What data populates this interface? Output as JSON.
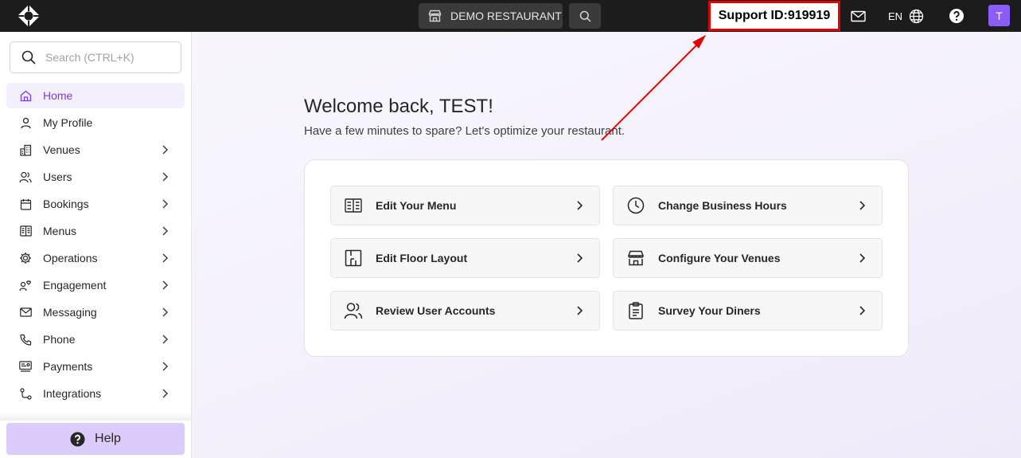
{
  "topbar": {
    "venue_name": "DEMO RESTAURANT",
    "support_id": "Support ID:919919",
    "language": "EN",
    "avatar_initial": "T"
  },
  "sidebar": {
    "search_placeholder": "Search (CTRL+K)",
    "items": [
      {
        "label": "Home",
        "icon": "home-icon",
        "active": true
      },
      {
        "label": "My Profile",
        "icon": "user-icon"
      },
      {
        "label": "Venues",
        "icon": "building-icon"
      },
      {
        "label": "Users",
        "icon": "users-icon"
      },
      {
        "label": "Bookings",
        "icon": "calendar-icon"
      },
      {
        "label": "Menus",
        "icon": "menu-book-icon"
      },
      {
        "label": "Operations",
        "icon": "cog-icon"
      },
      {
        "label": "Engagement",
        "icon": "engagement-icon"
      },
      {
        "label": "Messaging",
        "icon": "mail-icon"
      },
      {
        "label": "Phone",
        "icon": "phone-icon"
      },
      {
        "label": "Payments",
        "icon": "payments-icon"
      },
      {
        "label": "Integrations",
        "icon": "integrations-icon"
      }
    ],
    "help_label": "Help"
  },
  "main": {
    "welcome": "Welcome back, TEST!",
    "subtitle": "Have a few minutes to spare? Let's optimize your restaurant.",
    "actions": [
      {
        "label": "Edit Your Menu",
        "icon": "menu-book-icon"
      },
      {
        "label": "Change Business Hours",
        "icon": "clock-icon"
      },
      {
        "label": "Edit Floor Layout",
        "icon": "floor-layout-icon"
      },
      {
        "label": "Configure Your Venues",
        "icon": "storefront-icon"
      },
      {
        "label": "Review User Accounts",
        "icon": "users-icon"
      },
      {
        "label": "Survey Your Diners",
        "icon": "clipboard-icon"
      }
    ]
  },
  "colors": {
    "accent": "#7c3aed",
    "topbar": "#1c1c1c",
    "annotation": "#e00000"
  }
}
